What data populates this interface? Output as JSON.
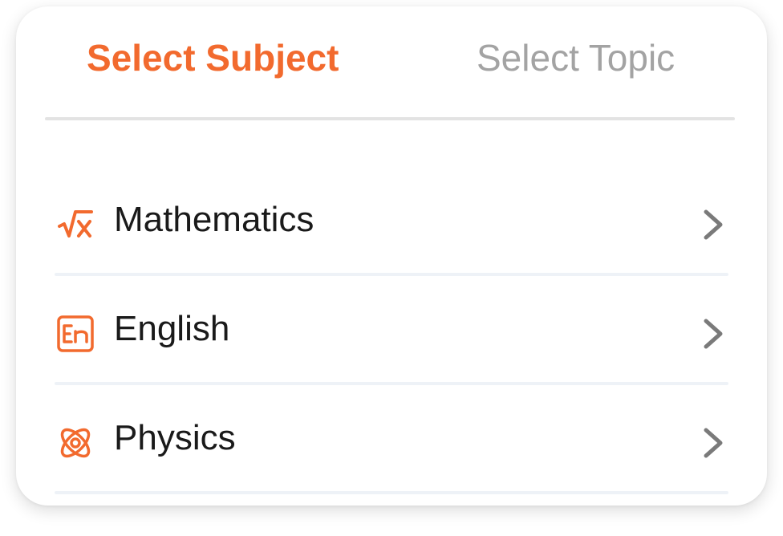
{
  "tabs": {
    "active": "Select Subject",
    "inactive": "Select Topic"
  },
  "subjects": [
    {
      "label": "Mathematics",
      "icon": "square-root-icon"
    },
    {
      "label": "English",
      "icon": "en-language-icon"
    },
    {
      "label": "Physics",
      "icon": "atom-icon"
    }
  ],
  "colors": {
    "accent": "#f26a2e",
    "inactive_tab": "#a3a3a3",
    "text": "#1a1a1a",
    "chevron": "#7a7a7a"
  }
}
